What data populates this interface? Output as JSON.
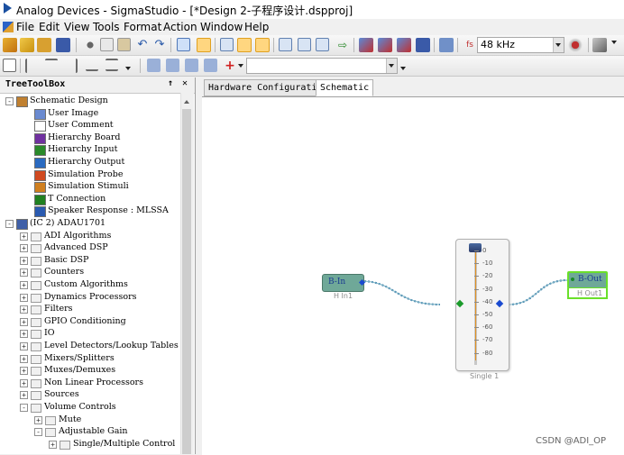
{
  "window": {
    "title": "Analog Devices - SigmaStudio - [*Design 2-子程序设计.dspproj]"
  },
  "menu": [
    "File",
    "Edit",
    "View",
    "Tools",
    "Format",
    "Action",
    "Window",
    "Help"
  ],
  "toolbar": {
    "sample_rate": "48 kHz"
  },
  "treetoolbox": {
    "title": "TreeToolBox",
    "pin_glyph": "↑",
    "close_glyph": "✕",
    "items": [
      {
        "label": "Schematic Design",
        "exp": "-"
      },
      {
        "label": "User Image"
      },
      {
        "label": "User Comment"
      },
      {
        "label": "Hierarchy Board"
      },
      {
        "label": "Hierarchy Input"
      },
      {
        "label": "Hierarchy Output"
      },
      {
        "label": "Simulation Probe"
      },
      {
        "label": "Simulation Stimuli"
      },
      {
        "label": "T Connection"
      },
      {
        "label": "Speaker Response : MLSSA"
      },
      {
        "label": "(IC 2) ADAU1701",
        "exp": "-"
      },
      {
        "label": "ADI Algorithms",
        "exp": "+"
      },
      {
        "label": "Advanced DSP",
        "exp": "+"
      },
      {
        "label": "Basic DSP",
        "exp": "+"
      },
      {
        "label": "Counters",
        "exp": "+"
      },
      {
        "label": "Custom Algorithms",
        "exp": "+"
      },
      {
        "label": "Dynamics Processors",
        "exp": "+"
      },
      {
        "label": "Filters",
        "exp": "+"
      },
      {
        "label": "GPIO Conditioning",
        "exp": "+"
      },
      {
        "label": "IO",
        "exp": "+"
      },
      {
        "label": "Level Detectors/Lookup Tables",
        "exp": "+"
      },
      {
        "label": "Mixers/Splitters",
        "exp": "+"
      },
      {
        "label": "Muxes/Demuxes",
        "exp": "+"
      },
      {
        "label": "Non Linear Processors",
        "exp": "+"
      },
      {
        "label": "Sources",
        "exp": "+"
      },
      {
        "label": "Volume Controls",
        "exp": "-"
      },
      {
        "label": "Mute",
        "exp": "+"
      },
      {
        "label": "Adjustable Gain",
        "exp": "-"
      },
      {
        "label": "Single/Multiple Control",
        "exp": "+"
      }
    ]
  },
  "tabs": [
    "Hardware Configuration",
    "Schematic"
  ],
  "schematic": {
    "input_block": {
      "text": "B-In",
      "sublabel": "H In1"
    },
    "output_block": {
      "text": "B-Out",
      "sublabel": "H Out1"
    },
    "volume": {
      "sublabel": "Single 1",
      "scale": [
        "0",
        "-10",
        "-20",
        "-30",
        "-40",
        "-50",
        "-60",
        "-70",
        "-80"
      ]
    }
  },
  "watermark": "CSDN @ADI_OP"
}
